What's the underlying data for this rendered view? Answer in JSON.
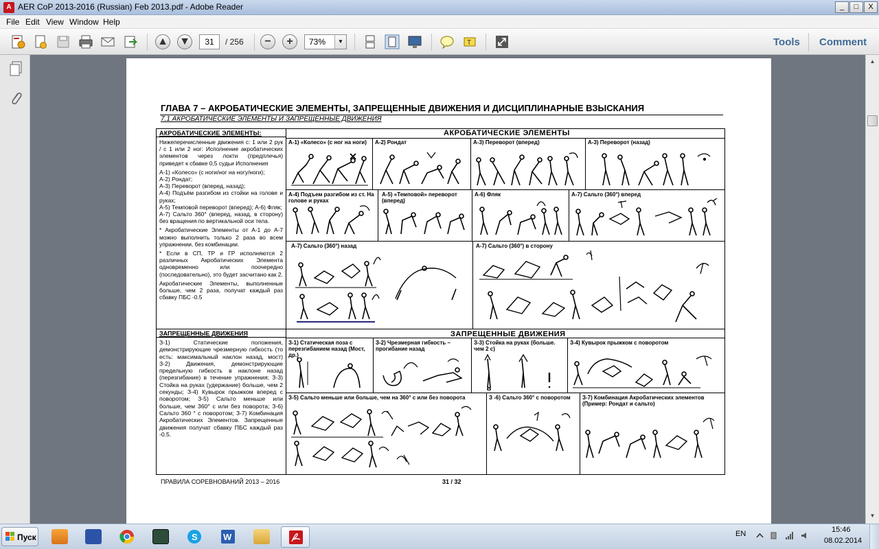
{
  "window": {
    "title": "AER CoP 2013-2016 (Russian) Feb 2013.pdf - Adobe Reader",
    "minimize": "_",
    "maximize": "□",
    "close": "X"
  },
  "menu": [
    "File",
    "Edit",
    "View",
    "Window",
    "Help"
  ],
  "toolbar": {
    "page_current": "31",
    "page_total": "/ 256",
    "zoom": "73%",
    "zoom_out": "−",
    "zoom_in": "+",
    "tools": "Tools",
    "comment": "Comment"
  },
  "document": {
    "title": "ГЛАВА 7 – АКРОБАТИЧЕСКИЕ ЭЛЕМЕНТЫ, ЗАПРЕЩЕННЫЕ ДВИЖЕНИЯ  И ДИСЦИПЛИНАРНЫЕ ВЗЫСКАНИЯ",
    "subtitle": "7.1  АКРОБАТИЧЕСКИЕ ЭЛЕМЕНТЫ И ЗАПРЕЩЕННЫЕ ДВИЖЕНИЯ",
    "left_head_acro": "АКРОБАТИЧЕСКИЕ    ЭЛЕМЕНТЫ:",
    "left_acro_p1": "Нижеперечисленные движения с: 1 или 2 рук / с 1 или 2 ног: Исполнение акробатических элементов через локти (предплечья) приведет к сбавке 0,5 судьи Исполнения",
    "left_acro_list": [
      "А-1) «Колесо» (с ноги/ног на ногу/ноги);",
      "А-2) Рондат;",
      "А-3) Переворот (вперед, назад);",
      "А-4) Подъём разгибом из стойки на голове и руках;",
      " А-5) Темповой переворот (вперед); А-6) Фляк;",
      " А-7) Сальто  360° (вперед, назад, в сторону) без вращения по вертикальной оси тела."
    ],
    "left_acro_p2": "* Акробатические Элементы от А-1 до  А-7 можно выполнить только 2 раза во всем упражнении,  без комбинации.",
    "left_acro_p3": "*   Если в СП, ТР и ГР исполняются 2 различных Акробатических Элемента одновременно или поочередно (последовательно), это будет засчитано как 2.",
    "left_acro_p4": " Акробатические Элементы, выполненные больше, чем 2 раза, получат каждый раз сбавку ПБС -0.5",
    "left_head_forb": "ЗАПРЕЩЕННЫЕ ДВИЖЕНИЯ",
    "left_forb_text": "З-1) Статические положения, демонстрирующие чрезмерную гибкость (то есть: максимальный наклон назад, мост)  З-2) Движения, демонстрирующие предельную гибкость в наклоне назад (перезгибание) в течение упражнения;  З-3) Стойка на руках (удержание) больше, чем 2 секунды; З-4) Кувырок прыжком вперед с поворотом;  З-5) Сальто меньше или больше, чем 360° с или без поворота; З-6) Сальто 360 ° с поворотом;  З-7) Комбинация Акробатических Элементов. Запрещенные движения получат сбавку ПБС каждый раз -0.5.",
    "acro_header": "АКРОБАТИЧЕСКИЕ  ЭЛЕМЕНТЫ",
    "forb_header": "ЗАПРЕЩЕННЫЕ ДВИЖЕНИЯ",
    "acro_cells": [
      "А-1) «Колесо» (с ног на ноги)",
      "А-2) Рондат",
      "А-3) Переворот (вперед)",
      "А-3) Переворот (назад)",
      "А-4) Подъем разгибом из ст. На голове и руках",
      "А-5) «Темповой» переворот (вперед)",
      "А-6) Фляк",
      "А-7) Сальто (360°) вперед",
      "А-7) Сальто (360°) назад",
      "А-7) Сальто (360°) в сторону"
    ],
    "forb_cells": [
      "З-1) Статическая поза  с перезгибанием назад (Мост, др.)",
      "З-2) Чрезмерная гибкость – прогибание назад",
      "З-3) Стойка на руках (больше. чем  2 с)",
      "З-4) Кувырок прыжком с поворотом",
      "З-5) Сальто меньше или больше, чем на 360° с или без поворота",
      "З -6) Сальто 360° с поворотом",
      "З-7) Комбинация Акробатических элементов (Пример:  Рондат и сальто)"
    ],
    "footer_left": "ПРАВИЛА СОРЕВНОВАНИЙ 2013 – 2016",
    "footer_page": "31 / 32"
  },
  "taskbar": {
    "start": "Пуск",
    "lang": "EN",
    "time": "15:46",
    "date": "08.02.2014"
  },
  "colors": {
    "title_bar": "#b7cbe4",
    "accent_link": "#3f6a96",
    "pdf_red": "#c8161d"
  }
}
